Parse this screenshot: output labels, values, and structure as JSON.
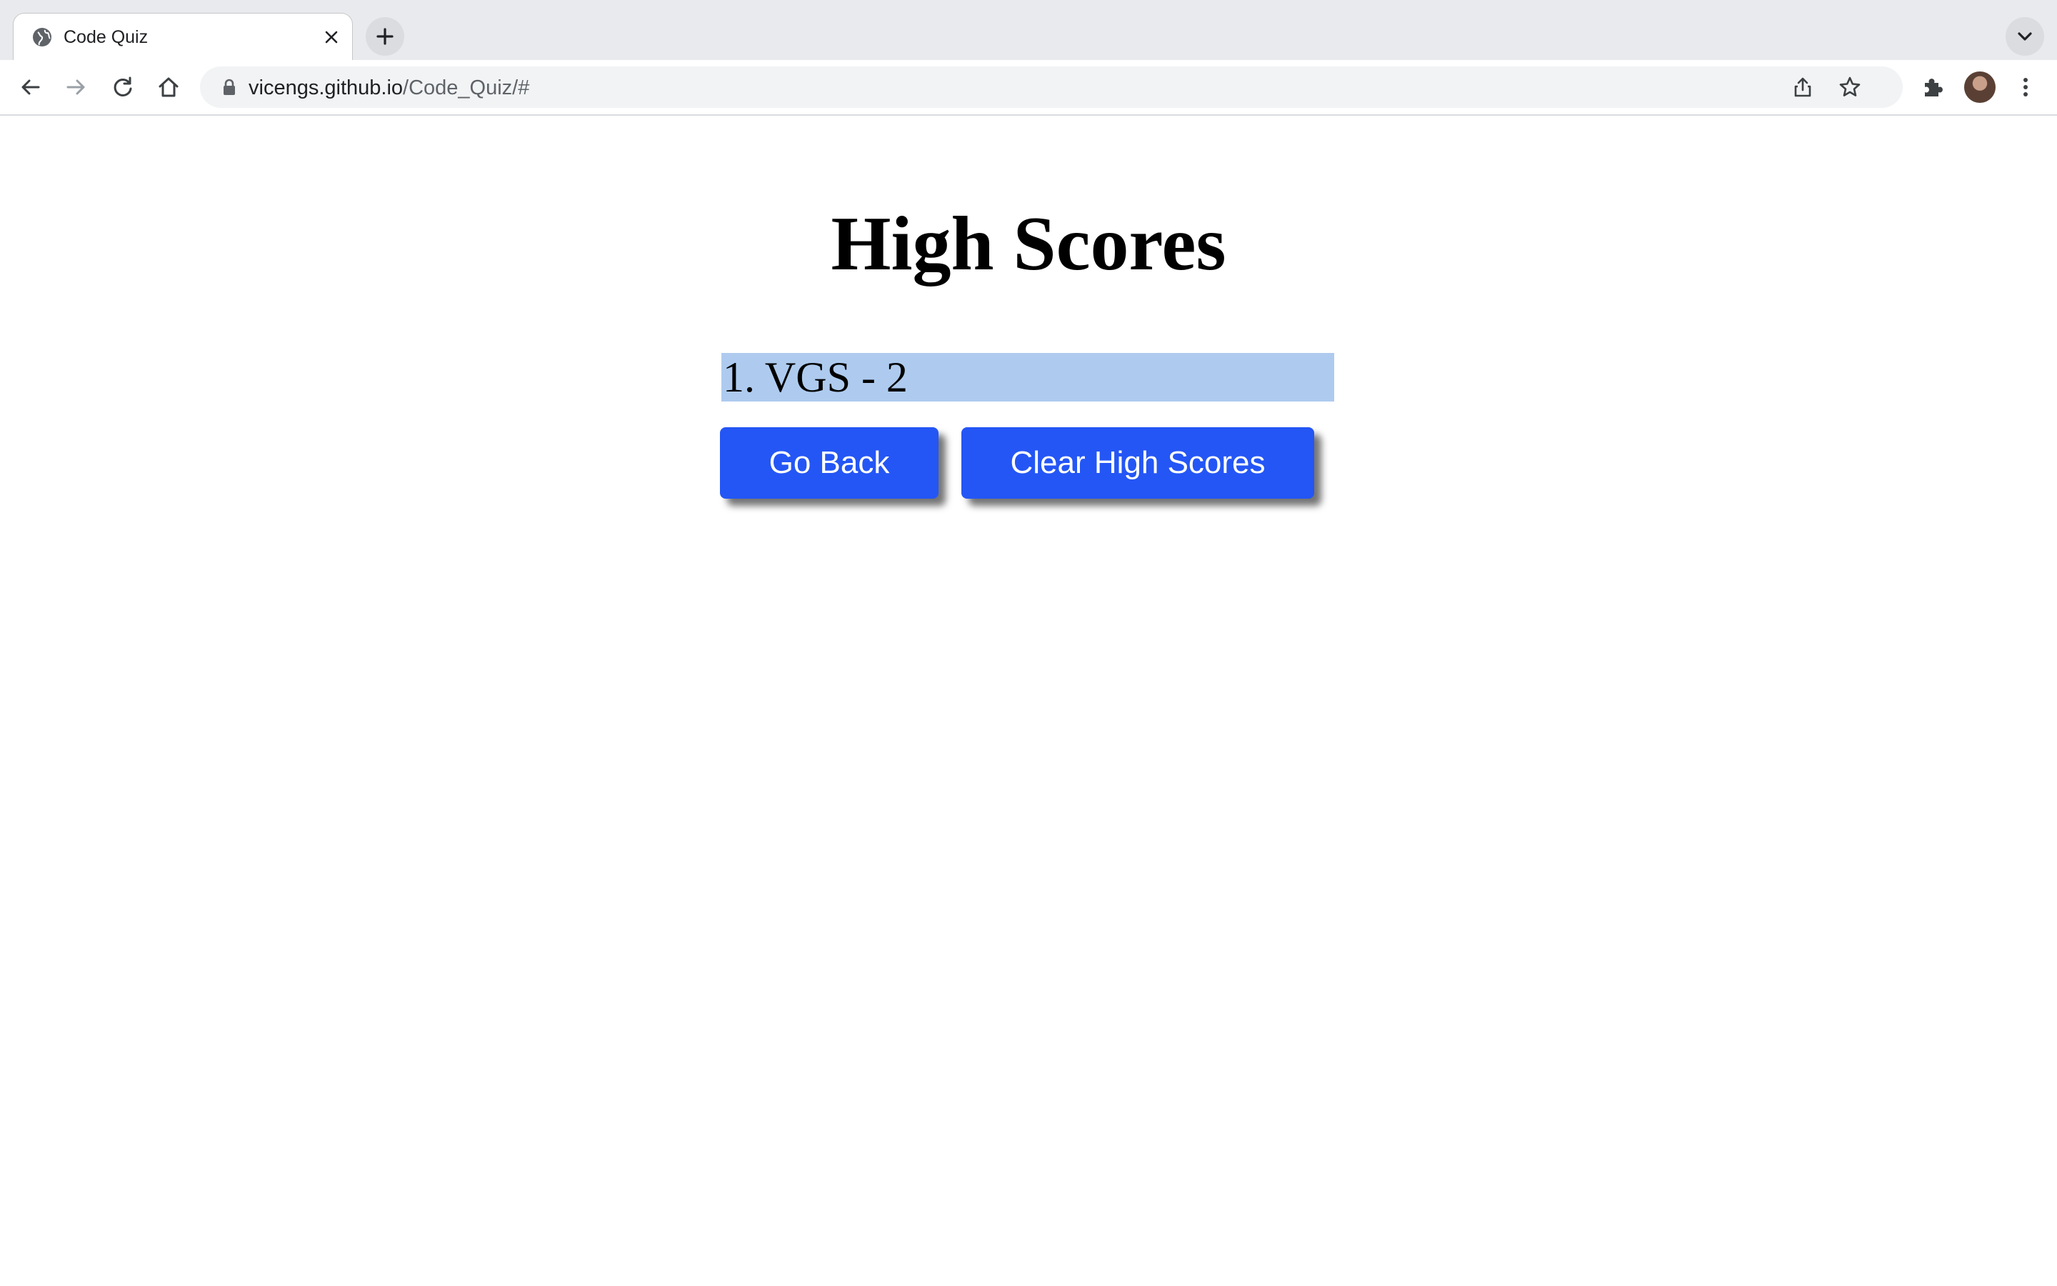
{
  "browser": {
    "tab": {
      "title": "Code Quiz"
    },
    "url": {
      "host": "vicengs.github.io",
      "path": "/Code_Quiz/#"
    }
  },
  "icons": {
    "favicon": "globe-icon",
    "tab_close": "close-icon",
    "new_tab": "plus-icon",
    "tab_list": "chevron-down-icon",
    "back": "arrow-left-icon",
    "forward": "arrow-right-icon",
    "reload": "reload-icon",
    "home": "home-icon",
    "lock": "lock-icon",
    "share": "share-icon",
    "bookmark": "star-icon",
    "extensions": "puzzle-icon",
    "menu": "kebab-menu-icon"
  },
  "page": {
    "title": "High Scores",
    "scores": [
      {
        "text": "1. VGS - 2"
      }
    ],
    "buttons": {
      "go_back": "Go Back",
      "clear": "Clear High Scores"
    }
  },
  "colors": {
    "button": "#2456f5",
    "score_highlight": "#aecbef"
  }
}
